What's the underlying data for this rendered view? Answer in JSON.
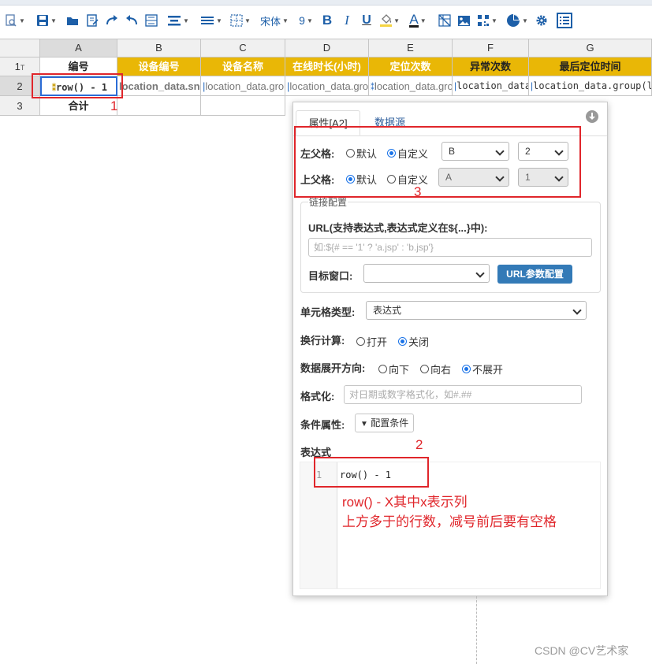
{
  "toolbar": {
    "font_name": "宋体",
    "font_size": "9",
    "bold": "B",
    "italic": "I",
    "underline": "U",
    "font_color_glyph": "A"
  },
  "grid": {
    "columns": [
      "A",
      "B",
      "C",
      "D",
      "E",
      "F",
      "G"
    ],
    "rows": [
      "1",
      "2",
      "3"
    ],
    "row1_marker": "T",
    "header_row": [
      "编号",
      "设备编号",
      "设备名称",
      "在线时长(小时)",
      "定位次数",
      "异常次数",
      "最后定位时间"
    ],
    "data_row": [
      "row() - 1",
      "location_data.sn",
      "location_data.grou",
      "location_data.grou",
      "location_data.grou",
      "location_data.g",
      "location_data.group(lastL"
    ],
    "total_label": "合计",
    "highlight_colors": {
      "header": "#e9b706"
    }
  },
  "annotations": {
    "marker1": "1",
    "marker2": "2",
    "marker3": "3",
    "note_line1": "row() - X其中x表示列",
    "note_line2": "上方多于的行数，减号前后要有空格"
  },
  "panel": {
    "tab_properties": "属性[A2]",
    "tab_datasource": "数据源",
    "left_parent_label": "左父格:",
    "top_parent_label": "上父格:",
    "opt_default": "默认",
    "opt_custom": "自定义",
    "left_parent_col": "B",
    "left_parent_row": "2",
    "top_parent_col": "A",
    "top_parent_row": "1",
    "link_config_legend": "链接配置",
    "url_label": "URL(支持表达式,表达式定义在${...}中):",
    "url_placeholder": "如:${# == '1' ? 'a.jsp' : 'b.jsp'}",
    "target_window_label": "目标窗口:",
    "target_window_value": "",
    "url_param_button": "URL参数配置",
    "cell_type_label": "单元格类型:",
    "cell_type_value": "表达式",
    "line_calc_label": "换行计算:",
    "opt_open": "打开",
    "opt_close": "关闭",
    "expand_label": "数据展开方向:",
    "opt_down": "向下",
    "opt_right": "向右",
    "opt_none": "不展开",
    "format_label": "格式化:",
    "format_placeholder": "对日期或数字格式化，如#.##",
    "condition_label": "条件属性:",
    "condition_button": "配置条件",
    "expression_label": "表达式",
    "code_line_no": "1",
    "code_line": "row() - 1"
  },
  "watermark": "CSDN @CV艺术家"
}
